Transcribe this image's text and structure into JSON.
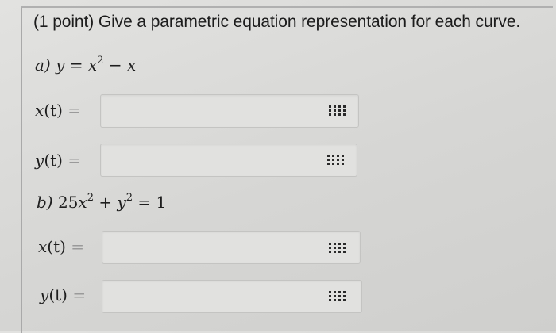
{
  "header": {
    "text": "(1 point) Give a parametric equation representation for each curve."
  },
  "part_a": {
    "label": "a)",
    "equation": {
      "y": "y",
      "eq": "=",
      "x": "x",
      "power": "2",
      "minus": "−",
      "x2": "x"
    },
    "rows": [
      {
        "fn": "x",
        "arg": "(t)",
        "eq": "=",
        "value": ""
      },
      {
        "fn": "y",
        "arg": "(t)",
        "eq": "=",
        "value": ""
      }
    ]
  },
  "part_b": {
    "label": "b)",
    "equation": {
      "coef": "25",
      "x": "x",
      "power": "2",
      "plus": "+",
      "y": "y",
      "power2": "2",
      "eq": "=",
      "rhs": "1"
    },
    "rows": [
      {
        "fn": "x",
        "arg": "(t)",
        "eq": "=",
        "value": ""
      },
      {
        "fn": "y",
        "arg": "(t)",
        "eq": "=",
        "value": ""
      }
    ]
  }
}
